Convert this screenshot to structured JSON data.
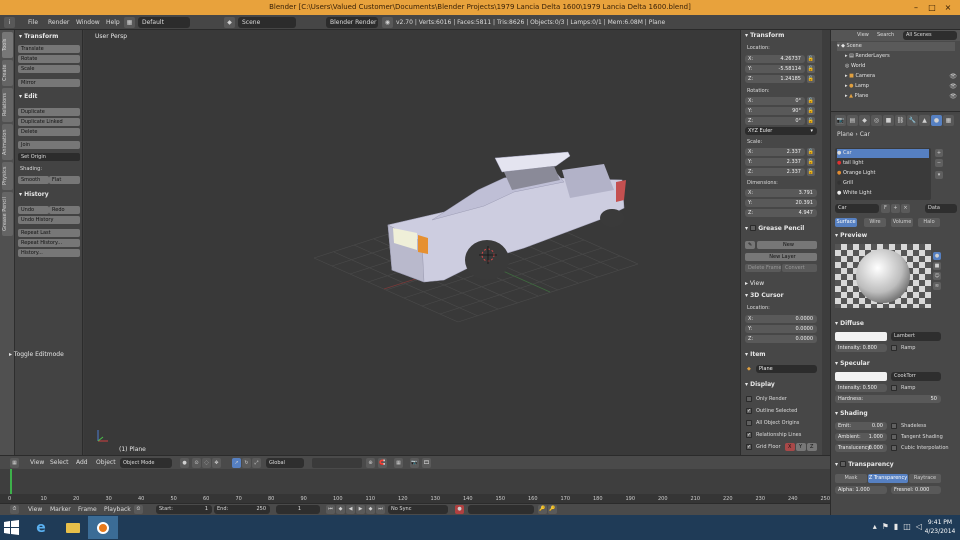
{
  "window": {
    "title": "Blender [C:\\Users\\Valued Customer\\Documents\\Blender Projects\\1979 Lancia Delta 1600\\1979 Lancia Delta 1600.blend]",
    "min_label": "–",
    "max_label": "□",
    "close_label": "×"
  },
  "menubar": {
    "file": "File",
    "render": "Render",
    "window": "Window",
    "help": "Help",
    "layout": "Default",
    "scene": "Scene",
    "engine": "Blender Render",
    "stats": "v2.70 | Verts:6016 | Faces:5811 | Tris:8626 | Objects:0/3 | Lamps:0/1 | Mem:6.08M | Plane"
  },
  "left_tabs": [
    "Tools",
    "Create",
    "Relations",
    "Animation",
    "Physics",
    "Grease Pencil"
  ],
  "tools": {
    "transform_header": "Transform",
    "translate": "Translate",
    "rotate": "Rotate",
    "scale": "Scale",
    "mirror": "Mirror",
    "edit_header": "Edit",
    "duplicate": "Duplicate",
    "duplicate_linked": "Duplicate Linked",
    "delete": "Delete",
    "join": "Join",
    "set_origin": "Set Origin",
    "shading_label": "Shading:",
    "smooth": "Smooth",
    "flat": "Flat",
    "history_header": "History",
    "undo": "Undo",
    "redo": "Redo",
    "undo_history": "Undo History",
    "repeat_last": "Repeat Last",
    "repeat_history": "Repeat History...",
    "history": "History...",
    "toggle_editmode": "Toggle Editmode"
  },
  "viewport": {
    "view_name": "User Persp",
    "object_name": "(1) Plane"
  },
  "npanel": {
    "transform_header": "Transform",
    "location_label": "Location:",
    "loc_x": "X:",
    "loc_x_val": "4.26737",
    "loc_y": "Y:",
    "loc_y_val": "-5.58114",
    "loc_z": "Z:",
    "loc_z_val": "1.24185",
    "rotation_label": "Rotation:",
    "rot_x": "X:",
    "rot_x_val": "0°",
    "rot_y": "Y:",
    "rot_y_val": "90°",
    "rot_z": "Z:",
    "rot_z_val": "0°",
    "rot_mode": "XYZ Euler",
    "scale_label": "Scale:",
    "sc_x": "X:",
    "sc_x_val": "2.337",
    "sc_y": "Y:",
    "sc_y_val": "2.337",
    "sc_z": "Z:",
    "sc_z_val": "2.337",
    "dimensions_label": "Dimensions:",
    "dim_x": "X:",
    "dim_x_val": "3.791",
    "dim_y": "Y:",
    "dim_y_val": "20.391",
    "dim_z": "Z:",
    "dim_z_val": "4.947",
    "grease_header": "Grease Pencil",
    "new_label": "New",
    "new_layer": "New Layer",
    "delete_frame": "Delete Frame",
    "convert": "Convert",
    "view_header": "View",
    "cursor_header": "3D Cursor",
    "cursor_location": "Location:",
    "cur_x": "X:",
    "cur_x_val": "0.0000",
    "cur_y": "Y:",
    "cur_y_val": "0.0000",
    "cur_z": "Z:",
    "cur_z_val": "0.0000",
    "item_header": "Item",
    "item_name": "Plane",
    "display_header": "Display",
    "only_render": "Only Render",
    "outline_selected": "Outline Selected",
    "all_object_origins": "All Object Origins",
    "relationship_lines": "Relationship Lines",
    "grid_floor": "Grid Floor",
    "grid_x": "X",
    "grid_y": "Y",
    "grid_z": "Z"
  },
  "outliner": {
    "view": "View",
    "search": "Search",
    "all_scenes": "All Scenes",
    "scene": "Scene",
    "render_layers": "RenderLayers",
    "world": "World",
    "camera": "Camera",
    "lamp": "Lamp",
    "plane": "Plane"
  },
  "properties": {
    "breadcrumb_object": "Plane",
    "breadcrumb_material": "Car",
    "slots": [
      "Car",
      "tail light",
      "Orange Light",
      "Grill",
      "White Light"
    ],
    "material_name": "Car",
    "material_link": "Data",
    "tab_surface": "Surface",
    "tab_wire": "Wire",
    "tab_volume": "Volume",
    "tab_halo": "Halo",
    "preview_header": "Preview",
    "diffuse_header": "Diffuse",
    "diffuse_shader": "Lambert",
    "diffuse_intensity": "Intensity: 0.800",
    "ramp": "Ramp",
    "specular_header": "Specular",
    "specular_shader": "CookTorr",
    "specular_intensity": "Intensity: 0.500",
    "hardness": "Hardness:",
    "hardness_val": "50",
    "shading_header": "Shading",
    "emit": "Emit:",
    "emit_val": "0.00",
    "ambient": "Ambient:",
    "ambient_val": "1.000",
    "translucency": "Translucency:",
    "translucency_val": "0.000",
    "shadeless": "Shadeless",
    "tangent_shading": "Tangent Shading",
    "cubic_interpolation": "Cubic Interpolation",
    "transparency_header": "Transparency",
    "mask": "Mask",
    "z_transparency": "Z Transparency",
    "raytrace": "Raytrace",
    "alpha": "Alpha: 1.000",
    "fresnel": "Fresnel: 0.000"
  },
  "vp_header": {
    "view": "View",
    "select": "Select",
    "add": "Add",
    "object": "Object",
    "mode": "Object Mode",
    "orientation": "Global"
  },
  "timeline": {
    "ticks": [
      "0",
      "10",
      "20",
      "30",
      "40",
      "50",
      "60",
      "70",
      "80",
      "90",
      "100",
      "110",
      "120",
      "130",
      "140",
      "150",
      "160",
      "170",
      "180",
      "190",
      "200",
      "210",
      "220",
      "230",
      "240",
      "250"
    ],
    "view": "View",
    "marker": "Marker",
    "frame": "Frame",
    "playback": "Playback",
    "start": "Start:",
    "start_val": "1",
    "end": "End:",
    "end_val": "250",
    "current": "1",
    "sync": "No Sync"
  },
  "taskbar": {
    "time": "9:41 PM",
    "date": "4/23/2014"
  },
  "colors": {
    "accent": "#5680c2",
    "title_bar": "#e8a23c",
    "taskbar": "#1f3b57"
  }
}
